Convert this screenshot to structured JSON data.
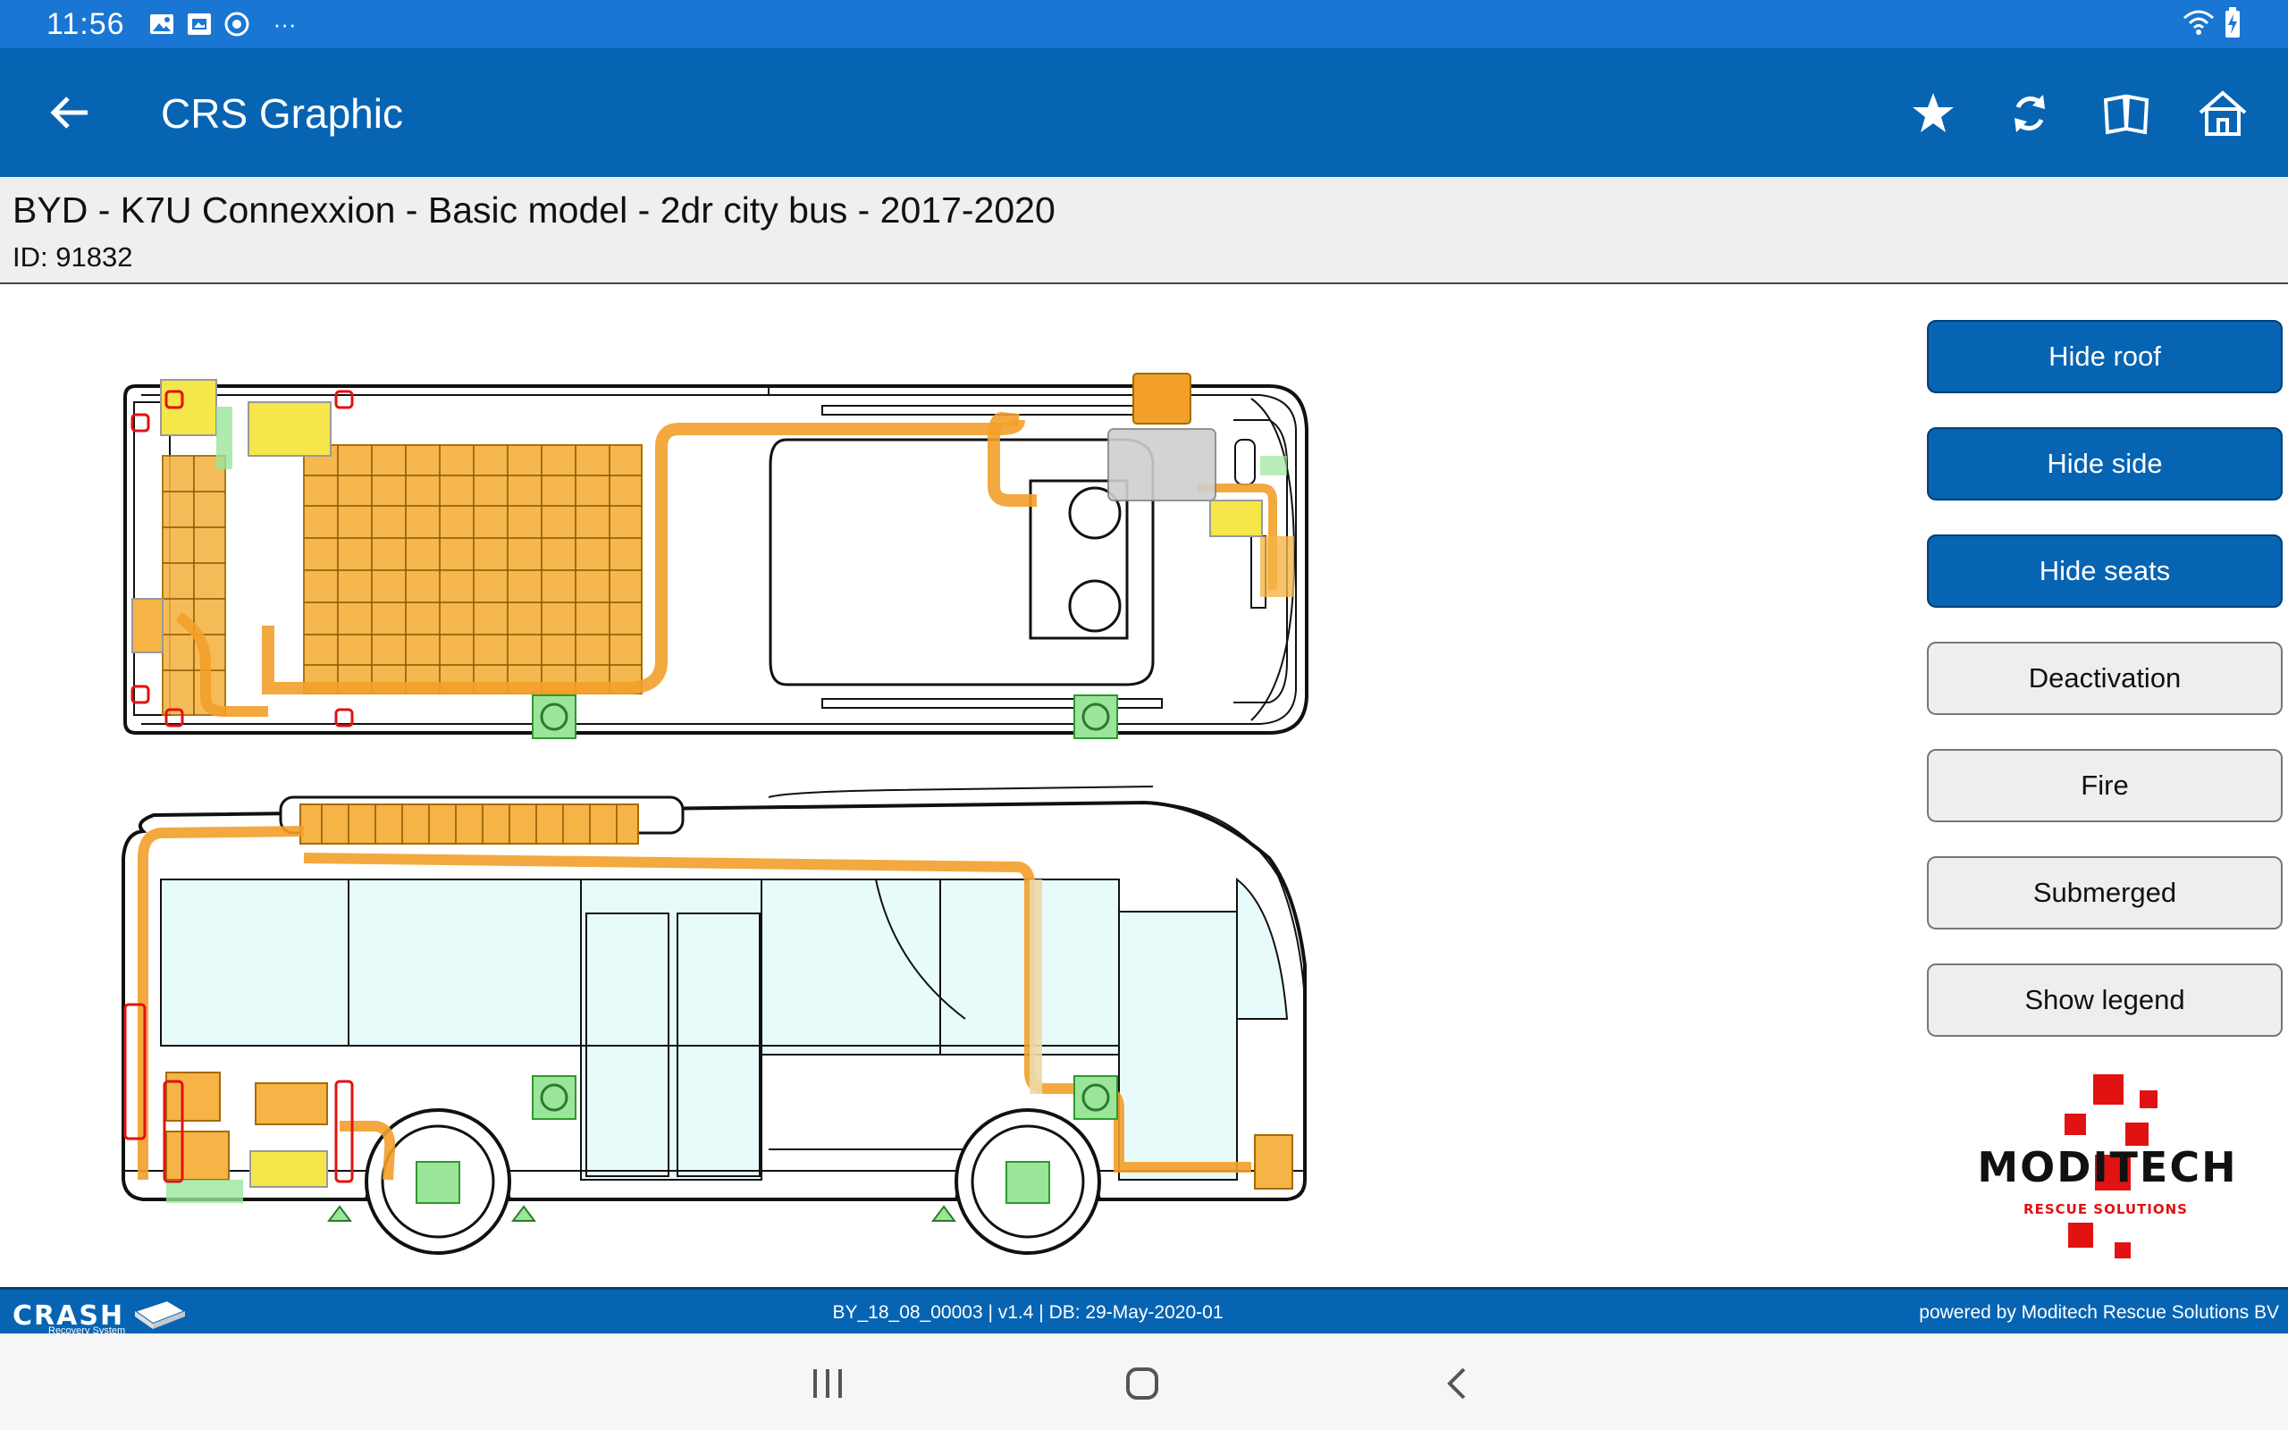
{
  "status_bar": {
    "time": "11:56",
    "more": "···",
    "icons": [
      "gallery-icon",
      "screenshot-icon",
      "chrome-icon"
    ],
    "right_icons": [
      "wifi-icon",
      "battery-charging-icon"
    ]
  },
  "app_bar": {
    "title": "CRS Graphic",
    "icons": [
      "back-arrow-icon",
      "star-icon",
      "refresh-icon",
      "book-icon",
      "home-icon"
    ]
  },
  "vehicle": {
    "title": "BYD - K7U Connexxion - Basic model - 2dr city bus - 2017-2020",
    "id_text": "ID: 91832"
  },
  "side_buttons": [
    {
      "label": "Hide roof",
      "style": "primary"
    },
    {
      "label": "Hide side",
      "style": "primary"
    },
    {
      "label": "Hide seats",
      "style": "primary"
    },
    {
      "label": "Deactivation",
      "style": "secondary"
    },
    {
      "label": "Fire",
      "style": "secondary"
    },
    {
      "label": "Submerged",
      "style": "secondary"
    },
    {
      "label": "Show legend",
      "style": "secondary"
    }
  ],
  "logo": {
    "name": "MODITECH",
    "tagline": "RESCUE SOLUTIONS"
  },
  "footer": {
    "brand": "CRASH",
    "brand_sub": "Recovery System",
    "build_info": "BY_18_08_00003 | v1.4 | DB: 29-May-2020-01",
    "powered_by": "powered by Moditech Rescue Solutions BV"
  },
  "colors": {
    "status_bar": "#1976d2",
    "app_bar": "#0764b3",
    "hv_component": "#f2a02a",
    "hv_battery": "#f5b445",
    "low_voltage": "#f5e64a",
    "airbag_sensor": "#9be59b",
    "moditech_red": "#e11212"
  },
  "diagram_icons": [
    "high-voltage-battery-icon",
    "hv-cable-icon",
    "12v-battery-icon",
    "fuse-icon",
    "gas-spring-icon",
    "airbag-icon",
    "jack-point-icon"
  ]
}
